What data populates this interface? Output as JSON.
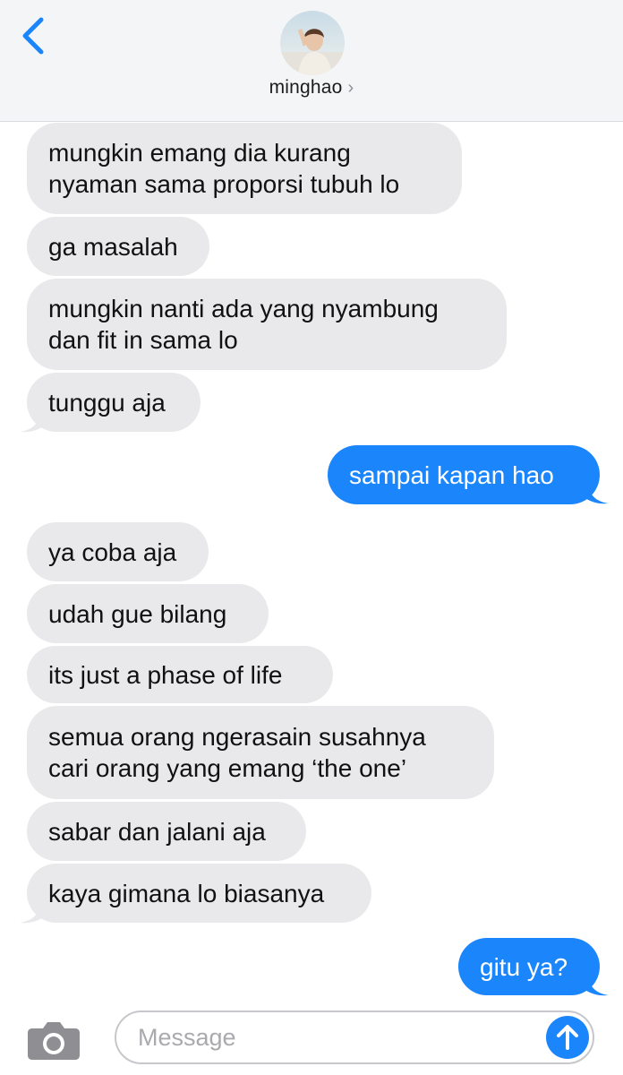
{
  "header": {
    "contact_name": "minghao",
    "chevron": "›",
    "back_icon": "chevron-left-icon",
    "avatar": "contact-photo"
  },
  "messages": [
    {
      "direction": "incoming",
      "text": "mungkin emang dia kurang\nnyaman sama proporsi tubuh lo"
    },
    {
      "direction": "incoming",
      "text": "ga masalah"
    },
    {
      "direction": "incoming",
      "text": "mungkin nanti ada yang nyambung\ndan fit in sama lo"
    },
    {
      "direction": "incoming",
      "text": "tunggu aja"
    },
    {
      "direction": "outgoing",
      "text": "sampai kapan hao"
    },
    {
      "direction": "incoming",
      "text": "ya coba aja"
    },
    {
      "direction": "incoming",
      "text": "udah gue bilang"
    },
    {
      "direction": "incoming",
      "text": "its just a phase of life"
    },
    {
      "direction": "incoming",
      "text": "semua orang ngerasain susahnya\ncari orang yang emang ‘the one’"
    },
    {
      "direction": "incoming",
      "text": "sabar dan jalani aja"
    },
    {
      "direction": "incoming",
      "text": "kaya gimana lo biasanya"
    },
    {
      "direction": "outgoing",
      "text": "gitu ya?"
    }
  ],
  "composer": {
    "placeholder": "Message",
    "value": "",
    "camera_icon": "camera-icon",
    "send_icon": "arrow-up-icon"
  },
  "colors": {
    "incoming_bubble": "#e9e9eb",
    "outgoing_bubble": "#1b86fb",
    "accent": "#1b86fb",
    "header_bg": "#f4f5f7"
  }
}
